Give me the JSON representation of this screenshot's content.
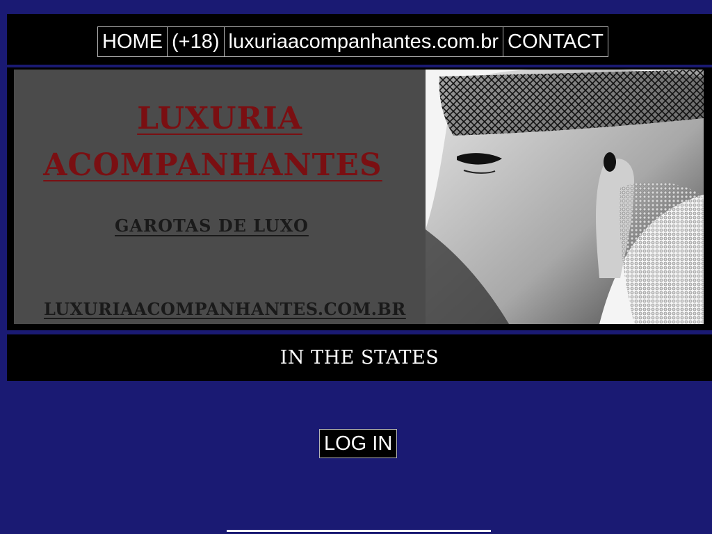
{
  "nav": {
    "items": [
      "HOME",
      "(+18)",
      "luxuriaacompanhantes.com.br",
      "CONTACT"
    ]
  },
  "banner": {
    "title_line1": "LUXURIA",
    "title_line2": "ACOMPANHANTES",
    "tagline": "GAROTAS DE LUXO",
    "url": "LUXURIAACOMPANHANTES.COM.BR",
    "photo_icon": "masked-woman-photo"
  },
  "section": {
    "heading": "IN THE STATES"
  },
  "login": {
    "label": "LOG IN"
  },
  "colors": {
    "page_background": "#1a1a73",
    "bar_background": "#000000",
    "banner_title": "#7a0f12",
    "banner_panel": "#4b4b4b"
  }
}
